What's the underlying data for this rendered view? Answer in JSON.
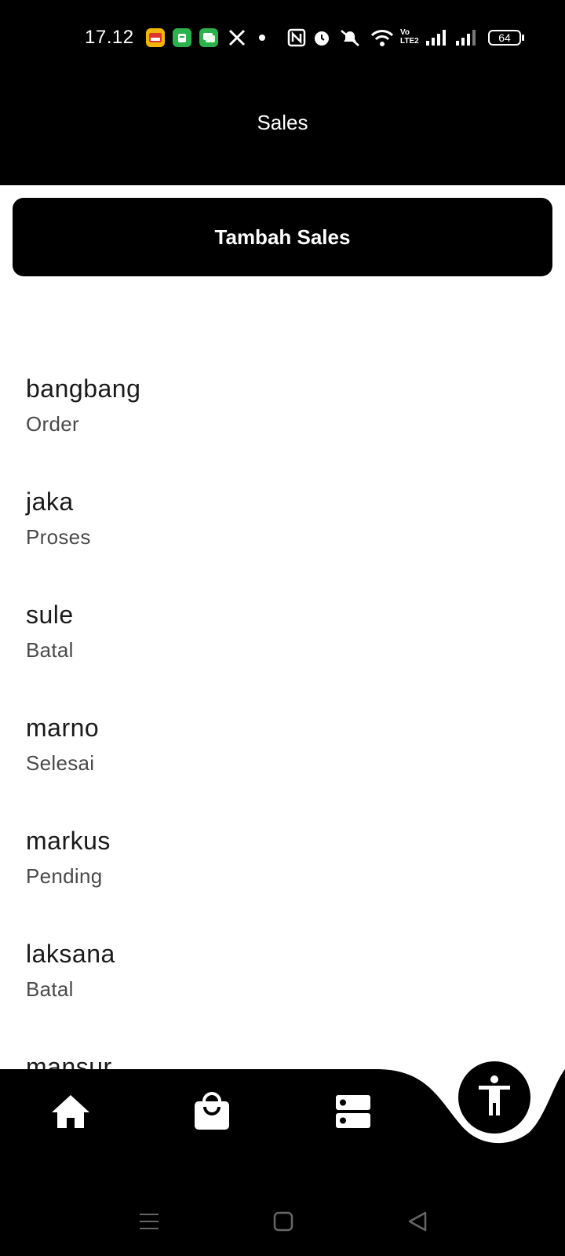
{
  "status_bar": {
    "time": "17.12",
    "battery": "64",
    "network_label": "Vo LTE2"
  },
  "app_bar": {
    "title": "Sales"
  },
  "add_button": {
    "label": "Tambah Sales"
  },
  "sales": [
    {
      "name": "bangbang",
      "status": "Order"
    },
    {
      "name": "jaka",
      "status": "Proses"
    },
    {
      "name": "sule",
      "status": "Batal"
    },
    {
      "name": "marno",
      "status": "Selesai"
    },
    {
      "name": "markus",
      "status": "Pending"
    },
    {
      "name": "laksana",
      "status": "Batal"
    },
    {
      "name": "mansur",
      "status": ""
    }
  ],
  "bottom_nav": {
    "items": [
      "home-icon",
      "shopping-bag-icon",
      "server-icon"
    ],
    "fab_icon": "accessibility-icon"
  },
  "system_nav": [
    "menu-icon",
    "home-square-icon",
    "back-triangle-icon"
  ],
  "colors": {
    "primary": "#000000",
    "background": "#ffffff",
    "text": "#1a1a1a",
    "subtext": "#4a4a4a"
  }
}
